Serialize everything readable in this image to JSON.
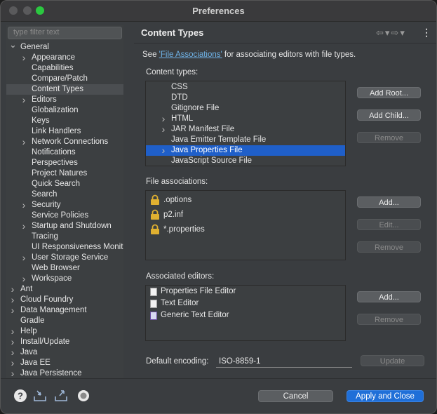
{
  "window": {
    "title": "Preferences"
  },
  "filter": {
    "placeholder": "type filter text"
  },
  "tree": [
    {
      "label": "General",
      "expanded": true,
      "level": 0
    },
    {
      "label": "Appearance",
      "level": 1,
      "chevron": true
    },
    {
      "label": "Capabilities",
      "level": 1
    },
    {
      "label": "Compare/Patch",
      "level": 1
    },
    {
      "label": "Content Types",
      "level": 1,
      "selected": true
    },
    {
      "label": "Editors",
      "level": 1,
      "chevron": true
    },
    {
      "label": "Globalization",
      "level": 1
    },
    {
      "label": "Keys",
      "level": 1
    },
    {
      "label": "Link Handlers",
      "level": 1
    },
    {
      "label": "Network Connections",
      "level": 1,
      "chevron": true
    },
    {
      "label": "Notifications",
      "level": 1
    },
    {
      "label": "Perspectives",
      "level": 1
    },
    {
      "label": "Project Natures",
      "level": 1
    },
    {
      "label": "Quick Search",
      "level": 1
    },
    {
      "label": "Search",
      "level": 1
    },
    {
      "label": "Security",
      "level": 1,
      "chevron": true
    },
    {
      "label": "Service Policies",
      "level": 1
    },
    {
      "label": "Startup and Shutdown",
      "level": 1,
      "chevron": true
    },
    {
      "label": "Tracing",
      "level": 1
    },
    {
      "label": "UI Responsiveness Monit",
      "level": 1
    },
    {
      "label": "User Storage Service",
      "level": 1,
      "chevron": true
    },
    {
      "label": "Web Browser",
      "level": 1
    },
    {
      "label": "Workspace",
      "level": 1,
      "chevron": true
    },
    {
      "label": "Ant",
      "level": 0,
      "chevron": true
    },
    {
      "label": "Cloud Foundry",
      "level": 0,
      "chevron": true
    },
    {
      "label": "Data Management",
      "level": 0,
      "chevron": true
    },
    {
      "label": "Gradle",
      "level": 0
    },
    {
      "label": "Help",
      "level": 0,
      "chevron": true
    },
    {
      "label": "Install/Update",
      "level": 0,
      "chevron": true
    },
    {
      "label": "Java",
      "level": 0,
      "chevron": true
    },
    {
      "label": "Java EE",
      "level": 0,
      "chevron": true
    },
    {
      "label": "Java Persistence",
      "level": 0,
      "chevron": true
    }
  ],
  "page": {
    "title": "Content Types",
    "see_prefix": "See ",
    "see_link": "'File Associations'",
    "see_suffix": " for associating editors with file types.",
    "content_types_label": "Content types:",
    "content_types": [
      {
        "label": "CSS"
      },
      {
        "label": "DTD"
      },
      {
        "label": "Gitignore File"
      },
      {
        "label": "HTML",
        "chevron": true
      },
      {
        "label": "JAR Manifest File",
        "chevron": true
      },
      {
        "label": "Java Emitter Template File"
      },
      {
        "label": "Java Properties File",
        "chevron": true,
        "selected": true
      },
      {
        "label": "JavaScript Source File"
      }
    ],
    "ct_buttons": {
      "add_root": "Add Root...",
      "add_child": "Add Child...",
      "remove": "Remove"
    },
    "file_assoc_label": "File associations:",
    "file_associations": [
      ".options",
      "p2.inf",
      "*.properties"
    ],
    "fa_buttons": {
      "add": "Add...",
      "edit": "Edit...",
      "remove": "Remove"
    },
    "assoc_editors_label": "Associated editors:",
    "associated_editors": [
      "Properties File Editor",
      "Text Editor",
      "Generic Text Editor"
    ],
    "ae_buttons": {
      "add": "Add...",
      "remove": "Remove"
    },
    "encoding_label": "Default encoding:",
    "encoding_value": "ISO-8859-1",
    "update": "Update"
  },
  "footer": {
    "cancel": "Cancel",
    "apply": "Apply and Close"
  }
}
